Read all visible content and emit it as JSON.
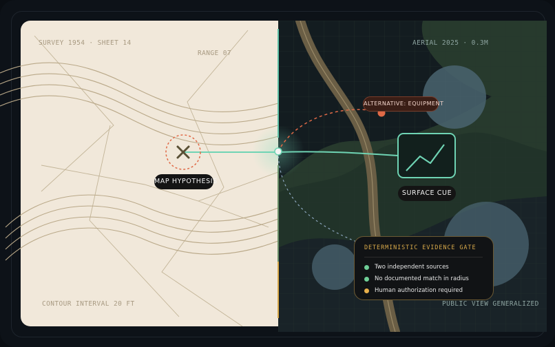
{
  "survey": {
    "title": "SURVEY 1954 · SHEET 14",
    "range": "RANGE 07",
    "contour_interval": "CONTOUR INTERVAL 20 FT",
    "hypothesis_label": "MAP HYPOTHESIS"
  },
  "aerial": {
    "title": "AERIAL 2025 · 0.3M",
    "alternative_label": "ALTERNATIVE: EQUIPMENT",
    "surface_cue_label": "SURFACE CUE",
    "footer": "PUBLIC VIEW GENERALIZED"
  },
  "evidence_gate": {
    "title": "DETERMINISTIC EVIDENCE GATE",
    "items": [
      {
        "text": "Two independent sources",
        "status_color": "#6fcf97"
      },
      {
        "text": "No documented match in radius",
        "status_color": "#6fcf97"
      },
      {
        "text": "Human authorization required",
        "status_color": "#e8b04b"
      }
    ]
  },
  "colors": {
    "teal_link": "#6fd4b4",
    "alternative_orange": "#e06a47",
    "gate_gold": "#d8a94a",
    "map_paper": "#f1e8da",
    "contour": "#b9a888"
  },
  "icons": {
    "hypothesis": "x-mark-icon",
    "surface_cue": "trend-line-icon",
    "split_handle": "divider-handle-icon"
  }
}
